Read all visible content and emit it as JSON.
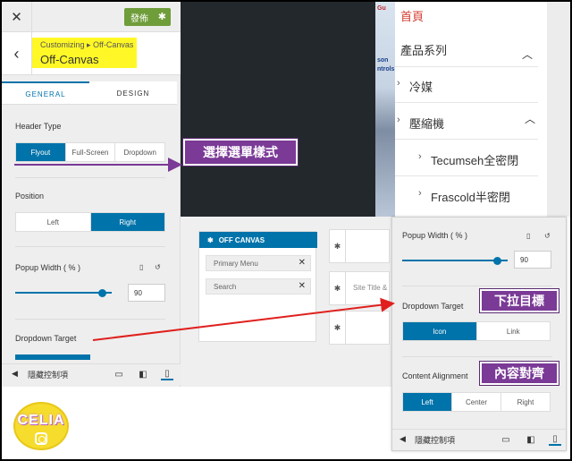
{
  "customizer": {
    "publish_label": "發佈",
    "breadcrumb": "Customizing ▸ Off-Canvas",
    "section_title": "Off-Canvas",
    "tabs": [
      "GENERAL",
      "DESIGN"
    ],
    "header_type": {
      "label": "Header Type",
      "options": [
        "Flyout",
        "Full-Screen",
        "Dropdown"
      ],
      "selected": "Flyout"
    },
    "position": {
      "label": "Position",
      "options": [
        "Left",
        "Right"
      ],
      "selected": "Right"
    },
    "popup_width": {
      "label": "Popup Width ( % )",
      "value": "90",
      "fraction": 0.9
    },
    "dropdown_target": {
      "label": "Dropdown Target"
    },
    "footer_hide": "隱藏控制項"
  },
  "site_menu": {
    "items": [
      "首頁",
      "產品系列",
      "冷媒",
      "壓縮機",
      "Tecumseh全密閉",
      "Frascold半密閉"
    ],
    "ad_text": [
      "Gu",
      "son",
      "ntrols"
    ]
  },
  "offcanvas_preview": {
    "title": "OFF CANVAS",
    "fields": [
      "Primary Menu",
      "Search"
    ],
    "side_text": "Site Title &"
  },
  "zoom_panel": {
    "popup_width": {
      "label": "Popup Width ( % )",
      "value": "90",
      "fraction": 0.9
    },
    "dropdown_target": {
      "label": "Dropdown Target",
      "options": [
        "Icon",
        "Link"
      ],
      "selected": "Icon"
    },
    "content_alignment": {
      "label": "Content Alignment",
      "options": [
        "Left",
        "Center",
        "Right"
      ],
      "selected": "Left"
    },
    "footer_hide": "隱藏控制項"
  },
  "annotations": {
    "select_style": "選擇選單樣式",
    "dropdown_target": "下拉目標",
    "content_align": "內容對齊"
  },
  "watermark": {
    "name": "CELIA"
  },
  "colors": {
    "accent": "#0073aa",
    "callout": "#7a3a96",
    "publish": "#6f9d3a",
    "menu_link": "#d23b2f"
  }
}
